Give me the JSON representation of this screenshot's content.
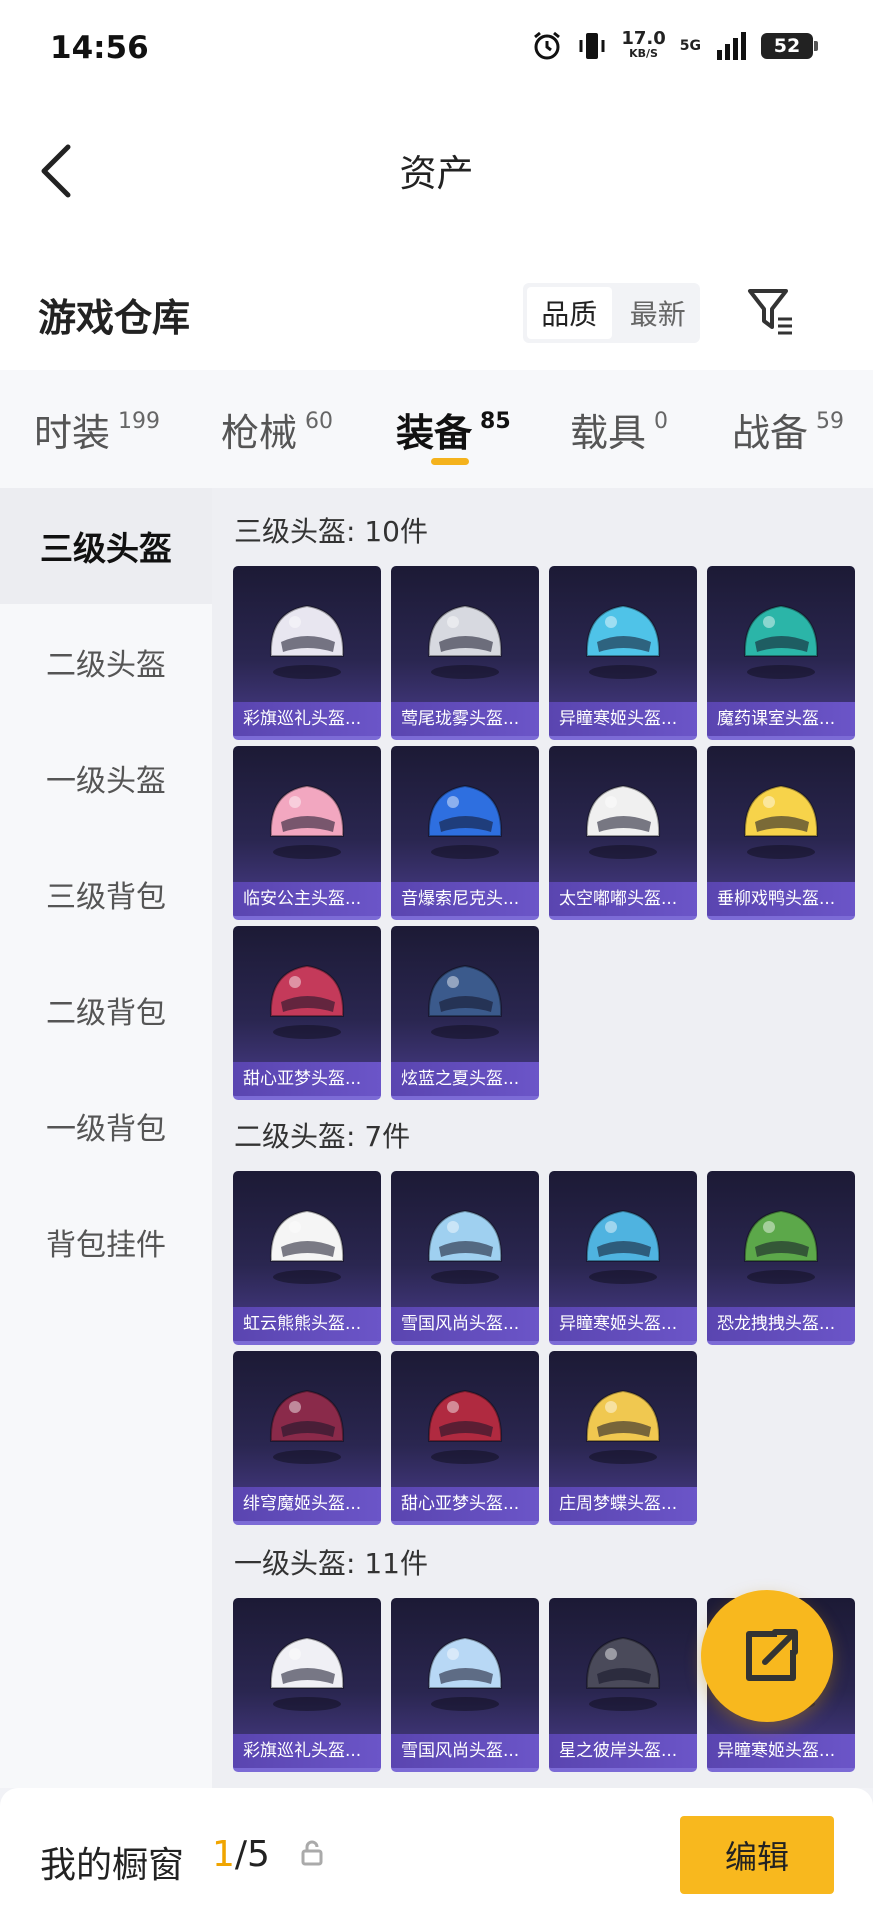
{
  "status": {
    "time": "14:56",
    "speed": "17.0",
    "speed_unit": "KB/S",
    "network": "5G",
    "battery": "52"
  },
  "nav": {
    "title": "资产"
  },
  "header": {
    "title": "游戏仓库",
    "sort_quality": "品质",
    "sort_latest": "最新"
  },
  "tabs": [
    {
      "label": "时装",
      "count": "199"
    },
    {
      "label": "枪械",
      "count": "60"
    },
    {
      "label": "装备",
      "count": "85"
    },
    {
      "label": "载具",
      "count": "0"
    },
    {
      "label": "战备",
      "count": "59"
    }
  ],
  "sidebar": [
    "三级头盔",
    "二级头盔",
    "一级头盔",
    "三级背包",
    "二级背包",
    "一级背包",
    "背包挂件"
  ],
  "sections": [
    {
      "title": "三级头盔: 10件",
      "items": [
        "彩旗巡礼头盔...",
        "莺尾珑雾头盔...",
        "异瞳寒姬头盔...",
        "魔药课室头盔...",
        "临安公主头盔...",
        "音爆索尼克头...",
        "太空嘟嘟头盔...",
        "垂柳戏鸭头盔...",
        "甜心亚梦头盔...",
        "炫蓝之夏头盔..."
      ]
    },
    {
      "title": "二级头盔: 7件",
      "items": [
        "虹云熊熊头盔...",
        "雪国风尚头盔...",
        "异瞳寒姬头盔...",
        "恐龙拽拽头盔...",
        "绯穹魔姬头盔...",
        "甜心亚梦头盔...",
        "庄周梦蝶头盔..."
      ]
    },
    {
      "title": "一级头盔: 11件",
      "items": [
        "彩旗巡礼头盔...",
        "雪国风尚头盔...",
        "星之彼岸头盔...",
        "异瞳寒姬头盔..."
      ]
    }
  ],
  "colors": [
    "#e8e6f0",
    "#d7d9e0",
    "#4fc3e8",
    "#2bb5a8",
    "#f2a7c0",
    "#2e6fe0",
    "#f0f0f0",
    "#f7d34a",
    "#c43a5a",
    "#3b5a8c",
    "#f5f5f5",
    "#9fd0f0",
    "#4fb3e0",
    "#5ca84a",
    "#8a2a4a",
    "#b02a40",
    "#f0c850",
    "#f0f0f5",
    "#b8d8f5",
    "#4a4a5a",
    "#6ec8ec"
  ],
  "bottom": {
    "title": "我的橱窗",
    "current": "1",
    "total": "/5",
    "edit_label": "编辑"
  }
}
